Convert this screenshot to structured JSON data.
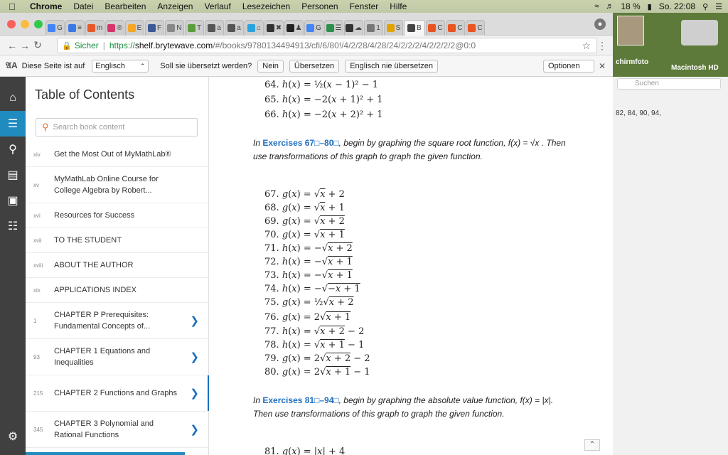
{
  "menubar": {
    "app": "Chrome",
    "items": [
      "Datei",
      "Bearbeiten",
      "Anzeigen",
      "Verlauf",
      "Lesezeichen",
      "Personen",
      "Fenster",
      "Hilfe"
    ],
    "battery": "18 %",
    "clock": "So. 22:08"
  },
  "tabs": [
    "G",
    "≡",
    "m",
    "®",
    "E",
    "F",
    "N",
    "T",
    "a",
    "a",
    "⌂",
    "✖",
    "♟",
    "G",
    "☰",
    "☁",
    "1",
    "S",
    "B",
    "C",
    "C",
    "C"
  ],
  "address": {
    "secure_label": "Sicher",
    "scheme": "https://",
    "domain": "shelf.brytewave.com",
    "path": "/#/books/9780134494913/cfi/6/80!/4/2/28/4/28/24/2/2/2/4/2/2/2/2@0:0"
  },
  "translate": {
    "prompt": "Diese Seite ist auf",
    "language": "Englisch",
    "question": "Soll sie übersetzt werden?",
    "no": "Nein",
    "translate": "Übersetzen",
    "never": "Englisch nie übersetzen",
    "options": "Optionen"
  },
  "toc": {
    "title": "Table of Contents",
    "search_placeholder": "Search book content",
    "items": [
      {
        "page": "xiv",
        "label": "Get the Most Out of MyMathLab®"
      },
      {
        "page": "xv",
        "label": "MyMathLab Online Course for College Algebra by Robert..."
      },
      {
        "page": "xvi",
        "label": "Resources for Success"
      },
      {
        "page": "xvii",
        "label": "TO THE STUDENT"
      },
      {
        "page": "xviii",
        "label": "ABOUT THE AUTHOR"
      },
      {
        "page": "xix",
        "label": "APPLICATIONS INDEX"
      },
      {
        "page": "1",
        "label": "CHAPTER P Prerequisites: Fundamental Concepts of..."
      },
      {
        "page": "93",
        "label": "CHAPTER 1 Equations and Inequalities"
      },
      {
        "page": "215",
        "label": "CHAPTER 2 Functions and Graphs"
      },
      {
        "page": "345",
        "label": "CHAPTER 3 Polynomial and Rational Functions"
      }
    ]
  },
  "content": {
    "p1_pre": "In",
    "p1_link": "Exercises 67□–80□",
    "p1_post": ", begin by graphing the square root function, f(x) = √x . Then use transformations of this graph to graph the given function.",
    "p2_pre": "In",
    "p2_link": "Exercises 81□–94□",
    "p2_post": ", begin by graphing the absolute value function, f(x) = |x|. Then use transformations of this graph to graph the given function."
  },
  "right_panel": {
    "search_placeholder": "Suchen",
    "text": "82, 84, 90, 94,"
  },
  "desktop": {
    "label1": "chirmfoto",
    "label2": "Macintosh HD"
  }
}
